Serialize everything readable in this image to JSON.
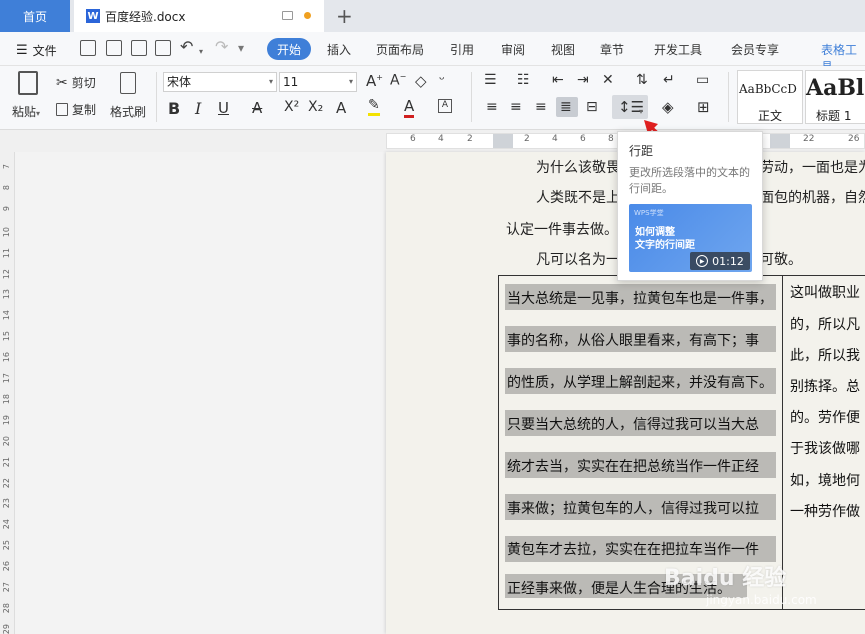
{
  "tabs": {
    "home": "首页",
    "doc_name": "百度经验.docx",
    "doc_icon": "W"
  },
  "menu": {
    "file": "文件",
    "items": [
      "开始",
      "插入",
      "页面布局",
      "引用",
      "审阅",
      "视图",
      "章节",
      "开发工具",
      "会员专享",
      "表格工具"
    ]
  },
  "ribbon": {
    "paste": "粘贴",
    "cut": "剪切",
    "copy": "复制",
    "format_painter": "格式刷",
    "font_name": "宋体",
    "font_size": "11",
    "style_normal_preview": "AaBbCcD",
    "style_normal": "正文",
    "style_h1_preview": "AaBl",
    "style_h1": "标题 1"
  },
  "ruler": {
    "h_ticks": [
      "6",
      "4",
      "2",
      "2",
      "4",
      "6",
      "8",
      "22",
      "26"
    ],
    "v_ticks": [
      "7",
      "8",
      "9",
      "10",
      "11",
      "12",
      "13",
      "14",
      "15",
      "16",
      "17",
      "18",
      "19",
      "20",
      "21",
      "22",
      "23",
      "24",
      "25",
      "26",
      "27",
      "28",
      "29"
    ]
  },
  "document": {
    "p1": "为什么该敬畏",
    "p1_tail": "劳动，一面也是为",
    "p2": "人类既不是上",
    "p2_tail": "面包的机器，自然",
    "p3": "认定一件事去做。",
    "p4": "凡可以名为一",
    "p4_tail": "可敬。",
    "table_left": [
      "当大总统是一见事，拉黄包车也是一件事，",
      "事的名称，从俗人眼里看来，有高下；事",
      "的性质，从学理上解剖起来，并没有高下。",
      "只要当大总统的人，信得过我可以当大总",
      "统才去当，实实在在把总统当作一件正经",
      "事来做；拉黄包车的人，信得过我可以拉",
      "黄包车才去拉，实实在在把拉车当作一件",
      "正经事来做，便是人生合理的生活。"
    ],
    "table_right": [
      "这叫做职业",
      "的，所以凡",
      "此，所以我",
      "别拣择。总",
      "的。劳作便",
      "于我该做哪",
      "如，境地何",
      "一种劳作做"
    ]
  },
  "tooltip": {
    "title": "行距",
    "desc": "更改所选段落中的文本的行间距。",
    "video_brand": "WPS学堂",
    "video_title_1": "如何调整",
    "video_title_2": "文字的行间距",
    "duration": "01:12"
  },
  "watermark": {
    "brand": "Baidu 经验",
    "url": "jingyan.baidu.com"
  },
  "colors": {
    "accent": "#3f7fd8",
    "selection": "#bbbab6",
    "arrow": "#e02020"
  }
}
